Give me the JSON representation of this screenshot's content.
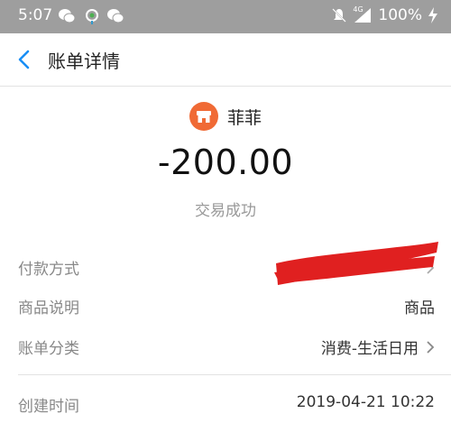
{
  "status_bar": {
    "time": "5:07",
    "network": "4G",
    "battery": "100%"
  },
  "header": {
    "title": "账单详情"
  },
  "transaction": {
    "merchant": "菲菲",
    "amount": "-200.00",
    "status": "交易成功"
  },
  "details": {
    "payment_method_label": "付款方式",
    "description_label": "商品说明",
    "description_value": "商品",
    "category_label": "账单分类",
    "category_value": "消费-生活日用",
    "created_label": "创建时间",
    "created_value": "2019-04-21 10:22"
  },
  "colors": {
    "accent": "#1a8ff5",
    "shop_icon": "#f06a35",
    "redaction": "#e02020",
    "status_bar": "#9e9e9e"
  }
}
